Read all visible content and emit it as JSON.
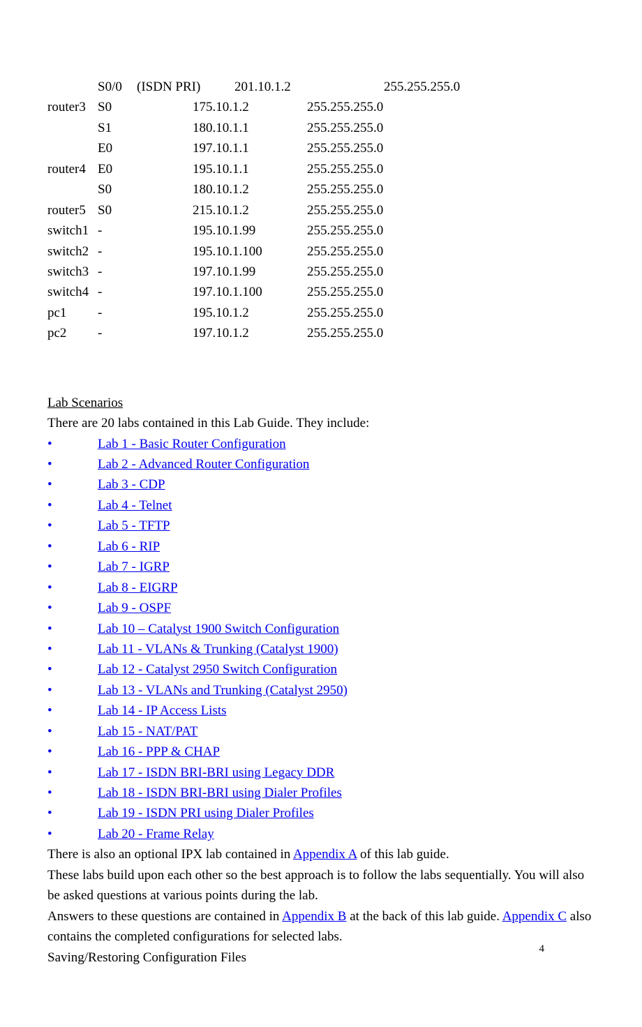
{
  "tableRows": [
    {
      "device": "",
      "iface": "S0/0",
      "desc": "(ISDN PRI)",
      "ip_indented": true,
      "ip": "201.10.1.2",
      "mask_indented": true,
      "mask": "255.255.255.0"
    },
    {
      "device": "router3",
      "iface": "S0",
      "desc": "",
      "ip_indented": false,
      "ip": "175.10.1.2",
      "mask_indented": false,
      "mask": "255.255.255.0"
    },
    {
      "device": "",
      "iface": "S1",
      "desc": "",
      "ip_indented": false,
      "ip": "180.10.1.1",
      "mask_indented": false,
      "mask": "255.255.255.0"
    },
    {
      "device": "",
      "iface": "E0",
      "desc": "",
      "ip_indented": false,
      "ip": "197.10.1.1",
      "mask_indented": false,
      "mask": "255.255.255.0"
    },
    {
      "device": "router4",
      "iface": "E0",
      "desc": "",
      "ip_indented": false,
      "ip": "195.10.1.1",
      "mask_indented": false,
      "mask": "255.255.255.0"
    },
    {
      "device": "",
      "iface": "S0",
      "desc": "",
      "ip_indented": false,
      "ip": "180.10.1.2",
      "mask_indented": false,
      "mask": "255.255.255.0"
    },
    {
      "device": "router5",
      "iface": "S0",
      "desc": "",
      "ip_indented": false,
      "ip": "215.10.1.2",
      "mask_indented": false,
      "mask": "255.255.255.0"
    },
    {
      "device": "switch1",
      "iface": "-",
      "desc": "",
      "ip_indented": false,
      "ip": "195.10.1.99",
      "mask_indented": false,
      "mask": "255.255.255.0"
    },
    {
      "device": "switch2",
      "iface": "-",
      "desc": "",
      "ip_indented": false,
      "ip": "195.10.1.100",
      "mask_indented": false,
      "mask": "255.255.255.0"
    },
    {
      "device": "switch3",
      "iface": "-",
      "desc": "",
      "ip_indented": false,
      "ip": "197.10.1.99",
      "mask_indented": false,
      "mask": "255.255.255.0"
    },
    {
      "device": "switch4",
      "iface": "-",
      "desc": "",
      "ip_indented": false,
      "ip": "197.10.1.100",
      "mask_indented": false,
      "mask": "255.255.255.0"
    },
    {
      "device": "pc1",
      "iface": "-",
      "desc": "",
      "ip_indented": false,
      "ip": "195.10.1.2",
      "mask_indented": false,
      "mask": "255.255.255.0"
    },
    {
      "device": "pc2",
      "iface": "-",
      "desc": "",
      "ip_indented": false,
      "ip": "197.10.1.2",
      "mask_indented": false,
      "mask": "255.255.255.0"
    }
  ],
  "sectionTitle": "Lab Scenarios",
  "intro": "There are 20 labs contained in this Lab Guide.    They include:",
  "bullet": "•",
  "labs": [
    "Lab 1 - Basic Router Configuration",
    "Lab 2 - Advanced Router Configuration",
    "Lab 3 - CDP",
    "Lab 4 - Telnet",
    "Lab 5 - TFTP",
    "Lab 6 - RIP",
    "Lab 7 - IGRP",
    "Lab 8 - EIGRP",
    "Lab 9 - OSPF",
    "Lab 10 – Catalyst 1900 Switch Configuration",
    "Lab 11 -    VLANs & Trunking (Catalyst 1900)",
    "Lab 12 -    Catalyst 2950 Switch Configuration",
    "Lab 13 - VLANs and Trunking (Catalyst 2950)",
    "Lab 14 - IP Access Lists",
    "Lab 15 - NAT/PAT",
    "Lab 16 - PPP & CHAP",
    "Lab 17 - ISDN BRI-BRI using Legacy DDR",
    "Lab 18 - ISDN BRI-BRI using Dialer Profiles",
    "Lab 19 - ISDN    PRI using Dialer Profiles ",
    "Lab 20 - Frame Relay"
  ],
  "p1_pre": "  There is also an optional IPX lab contained in ",
  "p1_link": "Appendix A",
  "p1_post": " of this lab guide.",
  "p2": "   These labs build upon each other so the best approach is to follow the labs sequentially.      You will also be asked questions at various points during the lab.",
  "p3_pre": "Answers to these questions are contained in ",
  "p3_link1": "Appendix B",
  "p3_mid": " at the back of this lab guide. ",
  "p3_link2": "Appendix C",
  "p3_post": " also contains the completed configurations for selected labs.",
  "p4": "Saving/Restoring Configuration Files",
  "pageNumber": "4"
}
